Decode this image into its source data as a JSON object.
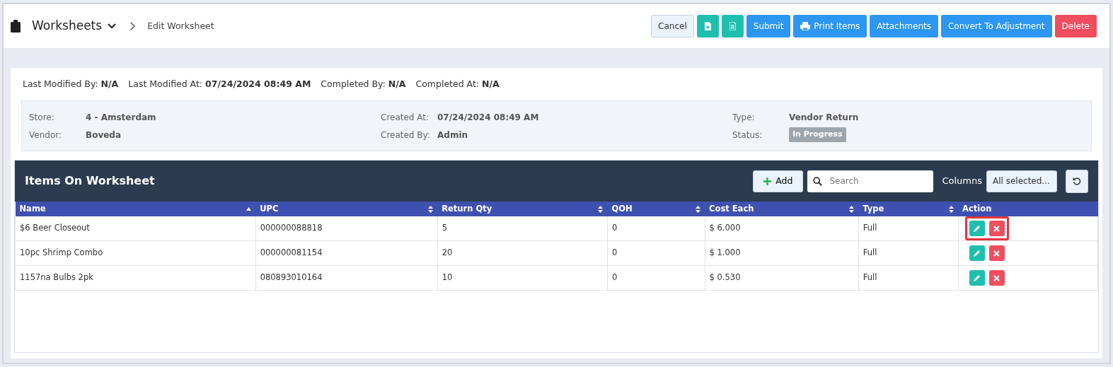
{
  "header": {
    "title": "Worksheets",
    "breadcrumb": "Edit Worksheet",
    "buttons": [
      {
        "kind": "light",
        "label": "Cancel"
      },
      {
        "kind": "teal-add"
      },
      {
        "kind": "teal-doc"
      },
      {
        "kind": "primary",
        "label": "Submit"
      },
      {
        "kind": "print",
        "label": "Print Items"
      },
      {
        "kind": "primary",
        "label": "Attachments"
      },
      {
        "kind": "primary",
        "label": "Convert To Adjustment"
      },
      {
        "kind": "danger",
        "label": "Delete"
      }
    ]
  },
  "meta": [
    {
      "label": "Last Modified By:",
      "value": "N/A"
    },
    {
      "label": "Last Modified At:",
      "value": "07/24/2024 08:49 AM"
    },
    {
      "label": "Completed By:",
      "value": "N/A"
    },
    {
      "label": "Completed At:",
      "value": "N/A"
    }
  ],
  "details": [
    [
      {
        "label": "Store:",
        "value": "4 - Amsterdam"
      },
      {
        "label": "Vendor:",
        "value": "Boveda"
      }
    ],
    [
      {
        "label": "Created At:",
        "value": "07/24/2024 08:49 AM"
      },
      {
        "label": "Created By:",
        "value": "Admin"
      }
    ],
    [
      {
        "label": "Type:",
        "value": "Vendor Return"
      },
      {
        "label": "Status:",
        "value": "In Progress",
        "kind": "badge"
      }
    ]
  ],
  "items": {
    "title": "Items On Worksheet",
    "add_label": "Add",
    "search": {
      "placeholder": "Search"
    },
    "columns_label": "Columns",
    "columns_value": "All selected...",
    "columns": [
      {
        "label": "Name",
        "kind": "sortable",
        "sorted": true
      },
      {
        "label": "UPC",
        "kind": "sortable",
        "sorted": false
      },
      {
        "label": "Return Qty",
        "kind": "sortable",
        "sorted": false
      },
      {
        "label": "QOH",
        "kind": "sortable",
        "sorted": false
      },
      {
        "label": "Cost Each",
        "kind": "sortable",
        "sorted": false
      },
      {
        "label": "Type",
        "kind": "sortable",
        "sorted": false
      },
      {
        "label": "Action",
        "kind": "plain"
      }
    ],
    "rows": [
      {
        "cells": [
          "$6 Beer Closeout",
          "000000088818",
          "5",
          "0",
          "$ 6.000",
          "Full"
        ],
        "highlighted": true
      },
      {
        "cells": [
          "10pc Shrimp Combo",
          "000000081154",
          "20",
          "0",
          "$ 1.000",
          "Full"
        ],
        "highlighted": false
      },
      {
        "cells": [
          "1157na Bulbs 2pk",
          "080893010164",
          "10",
          "0",
          "$ 0.530",
          "Full"
        ],
        "highlighted": false
      }
    ]
  }
}
